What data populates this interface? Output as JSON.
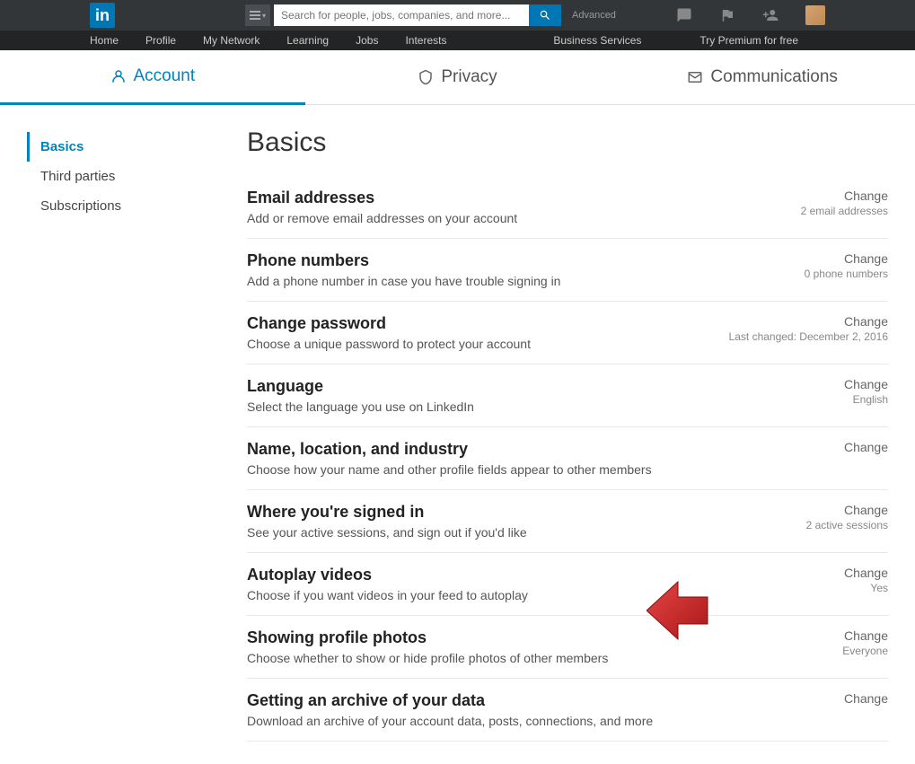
{
  "header": {
    "logo": "in",
    "search_placeholder": "Search for people, jobs, companies, and more...",
    "advanced": "Advanced"
  },
  "nav": {
    "home": "Home",
    "profile": "Profile",
    "network": "My Network",
    "learning": "Learning",
    "jobs": "Jobs",
    "interests": "Interests",
    "business": "Business Services",
    "premium": "Try Premium for free"
  },
  "tabs": {
    "account": "Account",
    "privacy": "Privacy",
    "communications": "Communications"
  },
  "sidebar": {
    "basics": "Basics",
    "third_parties": "Third parties",
    "subscriptions": "Subscriptions"
  },
  "page_title": "Basics",
  "change_label": "Change",
  "settings": [
    {
      "title": "Email addresses",
      "desc": "Add or remove email addresses on your account",
      "meta": "2 email addresses"
    },
    {
      "title": "Phone numbers",
      "desc": "Add a phone number in case you have trouble signing in",
      "meta": "0 phone numbers"
    },
    {
      "title": "Change password",
      "desc": "Choose a unique password to protect your account",
      "meta": "Last changed: December 2, 2016"
    },
    {
      "title": "Language",
      "desc": "Select the language you use on LinkedIn",
      "meta": "English"
    },
    {
      "title": "Name, location, and industry",
      "desc": "Choose how your name and other profile fields appear to other members",
      "meta": ""
    },
    {
      "title": "Where you're signed in",
      "desc": "See your active sessions, and sign out if you'd like",
      "meta": "2 active sessions"
    },
    {
      "title": "Autoplay videos",
      "desc": "Choose if you want videos in your feed to autoplay",
      "meta": "Yes"
    },
    {
      "title": "Showing profile photos",
      "desc": "Choose whether to show or hide profile photos of other members",
      "meta": "Everyone"
    },
    {
      "title": "Getting an archive of your data",
      "desc": "Download an archive of your account data, posts, connections, and more",
      "meta": ""
    }
  ]
}
